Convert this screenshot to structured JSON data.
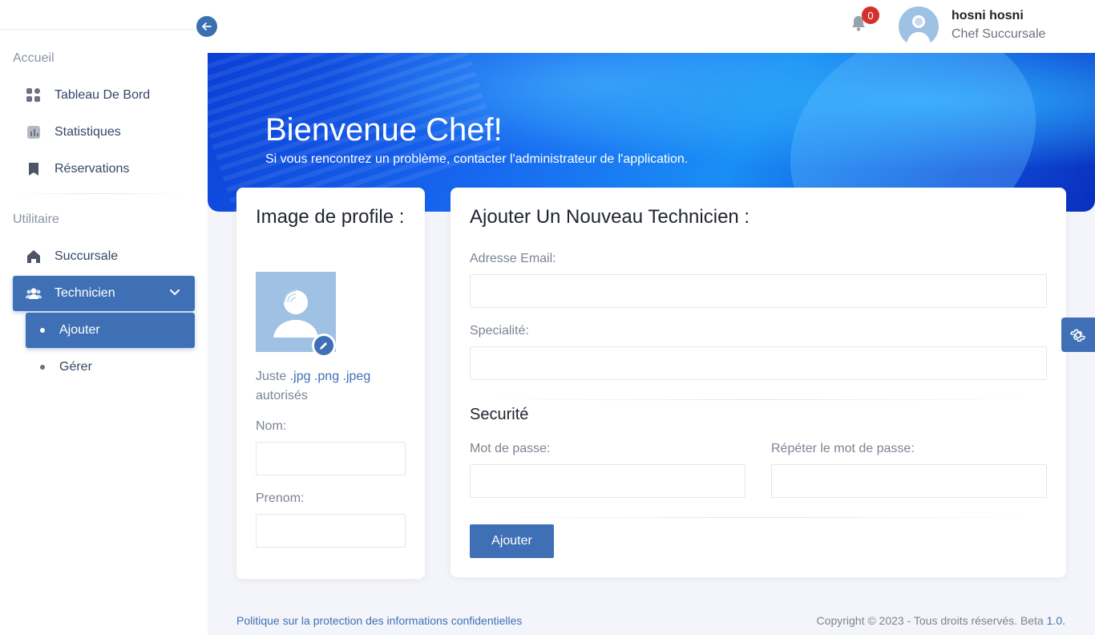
{
  "sidebar": {
    "sections": [
      {
        "title": "Accueil"
      },
      {
        "title": "Utilitaire"
      }
    ],
    "items": [
      {
        "label": "Tableau De Bord",
        "icon": "grid-icon"
      },
      {
        "label": "Statistiques",
        "icon": "chart-icon"
      },
      {
        "label": "Réservations",
        "icon": "bookmark-icon"
      },
      {
        "label": "Succursale",
        "icon": "home-icon"
      },
      {
        "label": "Technicien",
        "icon": "users-icon"
      }
    ],
    "subitems": [
      {
        "label": "Ajouter"
      },
      {
        "label": "Gérer"
      }
    ]
  },
  "topbar": {
    "notification_count": "0",
    "user_name": "hosni hosni",
    "user_role": "Chef Succursale"
  },
  "banner": {
    "title": "Bienvenue Chef!",
    "subtitle": "Si vous rencontrez un problème, contacter l'administrateur de l'application."
  },
  "profile_card": {
    "title": "Image de profile :",
    "hint_prefix": "Juste",
    "hint_ext": ".jpg .png .jpeg",
    "hint_suffix": "autorisés",
    "nom_label": "Nom:",
    "prenom_label": "Prenom:"
  },
  "tech_form": {
    "title": "Ajouter Un Nouveau Technicien :",
    "email_label": "Adresse Email:",
    "speciality_label": "Specialité:",
    "security_title": "Securité",
    "password_label": "Mot de passe:",
    "password_repeat_label": "Répéter le mot de passe:",
    "submit_label": "Ajouter"
  },
  "footer": {
    "privacy_link": "Politique sur la protection des informations confidentielles",
    "copyright": "Copyright © 2023 - Tous droits réservés. Beta",
    "version": "1.0."
  },
  "colors": {
    "primary": "#3f70b5",
    "badge": "#d3312b",
    "banner_dark": "#0b3fd6",
    "banner_light": "#2aa7f8"
  }
}
